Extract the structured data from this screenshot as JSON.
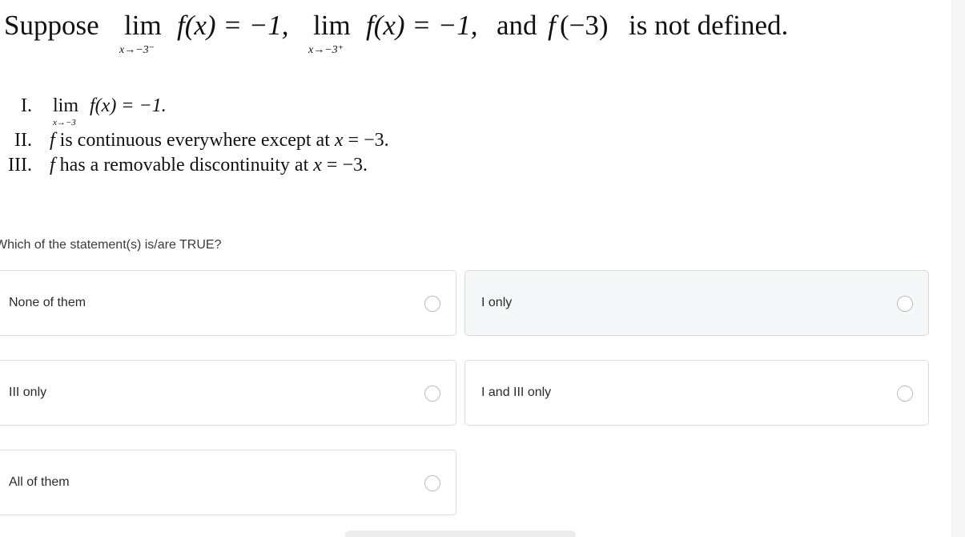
{
  "question": {
    "suppose": "Suppose",
    "lim": "lim",
    "lim1_sub": "x→−3⁻",
    "lim1_expr": "f(x) = −1,",
    "lim2_sub": "x→−3⁺",
    "lim2_expr": "f(x) = −1,",
    "and": "and",
    "tail_fn": "f",
    "tail_arg": "(−3)",
    "tail_rest": "is not defined."
  },
  "statements": [
    {
      "numeral": "I.",
      "lim": "lim",
      "sub": "x→−3",
      "text": "f(x) = −1."
    },
    {
      "numeral": "II.",
      "fn": "f",
      "text": "is continuous everywhere except at",
      "var": "x",
      "val": "= −3."
    },
    {
      "numeral": "III.",
      "fn": "f",
      "text": "has a removable discontinuity at",
      "var": "x",
      "val": "= −3."
    }
  ],
  "prompt": "Which of the statement(s) is/are TRUE?",
  "options": [
    {
      "label": "None of them"
    },
    {
      "label": "I only"
    },
    {
      "label": "III only"
    },
    {
      "label": "I and III only"
    },
    {
      "label": "All of them"
    }
  ]
}
